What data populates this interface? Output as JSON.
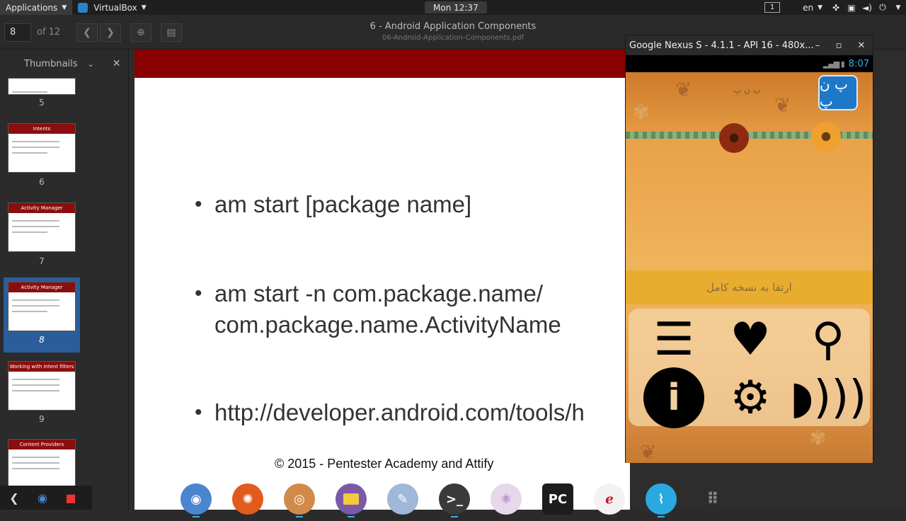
{
  "topbar": {
    "applications": "Applications",
    "virtualbox": "VirtualBox",
    "clock": "Mon 12:37",
    "workspace": "1",
    "language": "en"
  },
  "evince": {
    "page_current": "8",
    "page_of": "of 12",
    "title": "6 - Android Application Components",
    "subtitle": "06-Android-Application-Components.pdf",
    "sidebar_title": "Thumbnails",
    "thumbnails": [
      {
        "num": "5",
        "title": ""
      },
      {
        "num": "6",
        "title": "Intents"
      },
      {
        "num": "7",
        "title": "Activity Manager"
      },
      {
        "num": "8",
        "title": "Activity Manager"
      },
      {
        "num": "9",
        "title": "Working with Intent filters"
      },
      {
        "num": "",
        "title": "Content Providers"
      }
    ]
  },
  "slide": {
    "bullets": [
      "am start [package name]",
      "am start -n com.package.name/",
      "com.package.name.ActivityName",
      "http://developer.android.com/tools/h"
    ],
    "copyright": "© 2015 - Pentester Academy and Attify"
  },
  "emulator": {
    "window_title": "Google Nexus S - 4.1.1 - API 16 - 480x...",
    "status_time": "8:07",
    "app_title": "پ ن پ",
    "logo_text": "پ ن پ",
    "upgrade_label": "ارتقا به نسخه کامل"
  },
  "colors": {
    "slide_band": "#8b0000",
    "selected_thumb": "#2b5d9a",
    "status_blue": "#33b5e5"
  },
  "icons": [
    "list-icon",
    "heart-icon",
    "search-icon",
    "info-icon",
    "settings-gear-icon",
    "speaker-icon"
  ]
}
